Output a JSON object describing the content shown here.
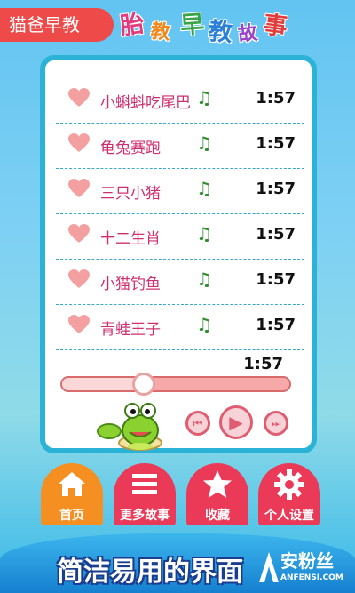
{
  "header": {
    "app_name": "猫爸早教",
    "title_chars": [
      "胎",
      "教",
      "早",
      "教",
      "故",
      "事"
    ]
  },
  "playlist": {
    "songs": [
      {
        "name": "小蝌蚪吃尾巴",
        "duration": "1:57"
      },
      {
        "name": "龟兔赛跑",
        "duration": "1:57"
      },
      {
        "name": "三只小猪",
        "duration": "1:57"
      },
      {
        "name": "十二生肖",
        "duration": "1:57"
      },
      {
        "name": "小猫钓鱼",
        "duration": "1:57"
      },
      {
        "name": "青蛙王子",
        "duration": "1:57"
      }
    ]
  },
  "player": {
    "total_time": "1:57",
    "progress_fraction": 0.36
  },
  "nav": {
    "home": "首页",
    "more_stories": "更多故事",
    "favorites": "收藏",
    "settings": "个人设置"
  },
  "banner": {
    "caption": "简洁易用的界面"
  },
  "watermark": {
    "top": "安粉丝",
    "bottom": "ANFENSI.COM"
  },
  "colors": {
    "accent_red": "#ea3a57",
    "home_orange": "#f58f22",
    "card_border": "#2ab3d6",
    "song_title": "#cf2f70"
  }
}
